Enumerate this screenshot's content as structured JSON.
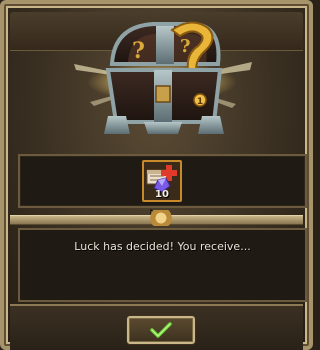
{
  "dialog": {
    "reward_item": {
      "quantity": "10",
      "icon": "gift-box-with-crystal-icon"
    },
    "message": "Luck has decided! You receive...",
    "confirm_button": {
      "icon": "checkmark-icon"
    }
  },
  "colors": {
    "frame": "#a8946a",
    "panel": "#1f1a14",
    "slot_border": "#c88a2a",
    "checkmark": "#6bd03a",
    "text": "#e8e3d6"
  },
  "chest": {
    "icon": "mystery-chest-icon",
    "coin_badge": "1"
  }
}
